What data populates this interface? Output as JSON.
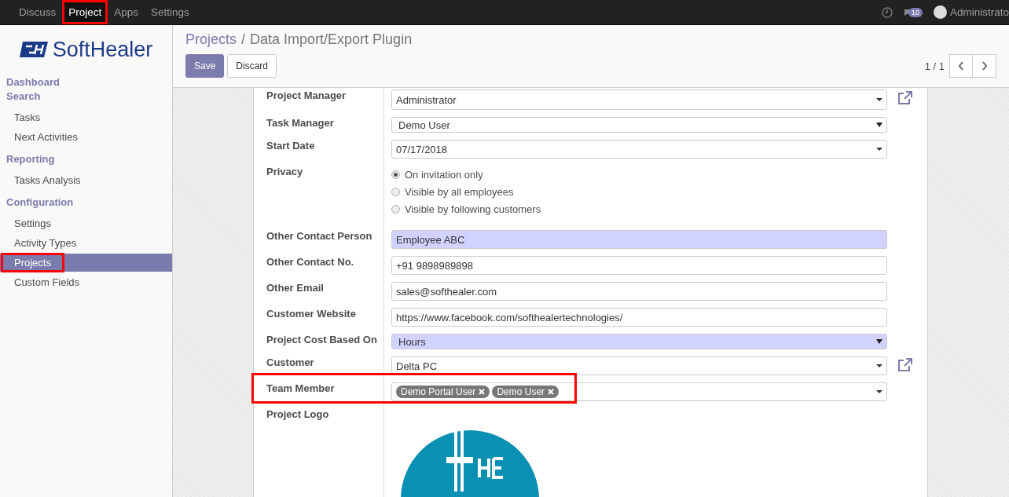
{
  "top_menu": [
    {
      "label": "Discuss",
      "selected": false,
      "highlighted": false
    },
    {
      "label": "Project",
      "selected": true,
      "highlighted": true
    },
    {
      "label": "Apps",
      "selected": false,
      "highlighted": false
    },
    {
      "label": "Settings",
      "selected": false,
      "highlighted": false
    }
  ],
  "systray": {
    "messages_count": "10",
    "user": "Administrato"
  },
  "logo": {
    "text": "SoftHealer"
  },
  "sidebar": {
    "sections": [
      {
        "title": "Dashboard"
      },
      {
        "title": "Search",
        "items": [
          {
            "label": "Tasks",
            "selected": false,
            "highlighted": false
          },
          {
            "label": "Next Activities",
            "selected": false,
            "highlighted": false
          }
        ]
      },
      {
        "title": "Reporting",
        "items": [
          {
            "label": "Tasks Analysis",
            "selected": false,
            "highlighted": false
          }
        ]
      },
      {
        "title": "Configuration",
        "items": [
          {
            "label": "Settings",
            "selected": false,
            "highlighted": false
          },
          {
            "label": "Activity Types",
            "selected": false,
            "highlighted": false
          },
          {
            "label": "Projects",
            "selected": true,
            "highlighted": true
          },
          {
            "label": "Custom Fields",
            "selected": false,
            "highlighted": false
          }
        ]
      }
    ]
  },
  "breadcrumb": {
    "parent": "Projects",
    "separator": "/",
    "current": "Data Import/Export Plugin"
  },
  "buttons": [
    {
      "label": "Save",
      "kind": "primary"
    },
    {
      "label": "Discard",
      "kind": "secondary"
    }
  ],
  "pager": {
    "text": "1 / 1"
  },
  "form": {
    "fields": [
      {
        "label": "Project Manager",
        "kind": "many2one",
        "value": "Administrator",
        "required": false,
        "external_link": true,
        "highlighted": false
      },
      {
        "label": "Task Manager",
        "kind": "select",
        "value": "Demo User",
        "required": false,
        "external_link": false,
        "highlighted": false
      },
      {
        "label": "Start Date",
        "kind": "many2one",
        "value": "07/17/2018",
        "required": false,
        "external_link": false,
        "highlighted": false
      },
      {
        "label": "Privacy",
        "kind": "radio",
        "options": [
          {
            "label": "On invitation only",
            "selected": true
          },
          {
            "label": "Visible by all employees",
            "selected": false
          },
          {
            "label": "Visible by following customers",
            "selected": false
          }
        ],
        "highlighted": false
      },
      {
        "label": "Other Contact Person",
        "kind": "char",
        "value": "Employee ABC",
        "required": true,
        "external_link": false,
        "highlighted": false
      },
      {
        "label": "Other Contact No.",
        "kind": "char",
        "value": "+91 9898989898",
        "required": false,
        "external_link": false,
        "highlighted": false
      },
      {
        "label": "Other Email",
        "kind": "char",
        "value": "sales@softhealer.com",
        "required": false,
        "external_link": false,
        "highlighted": false
      },
      {
        "label": "Customer Website",
        "kind": "char",
        "value": "https://www.facebook.com/softhealertechnologies/",
        "required": false,
        "external_link": false,
        "highlighted": false
      },
      {
        "label": "Project Cost Based On",
        "kind": "select",
        "value": "Hours",
        "required": true,
        "external_link": false,
        "highlighted": false
      },
      {
        "label": "Customer",
        "kind": "many2one",
        "value": "Delta PC",
        "required": false,
        "external_link": true,
        "highlighted": false
      },
      {
        "label": "Team Member",
        "kind": "tags",
        "tags": [
          "Demo Portal User",
          "Demo User"
        ],
        "highlighted": true
      },
      {
        "label": "Project Logo",
        "kind": "image",
        "highlighted": false
      }
    ]
  }
}
